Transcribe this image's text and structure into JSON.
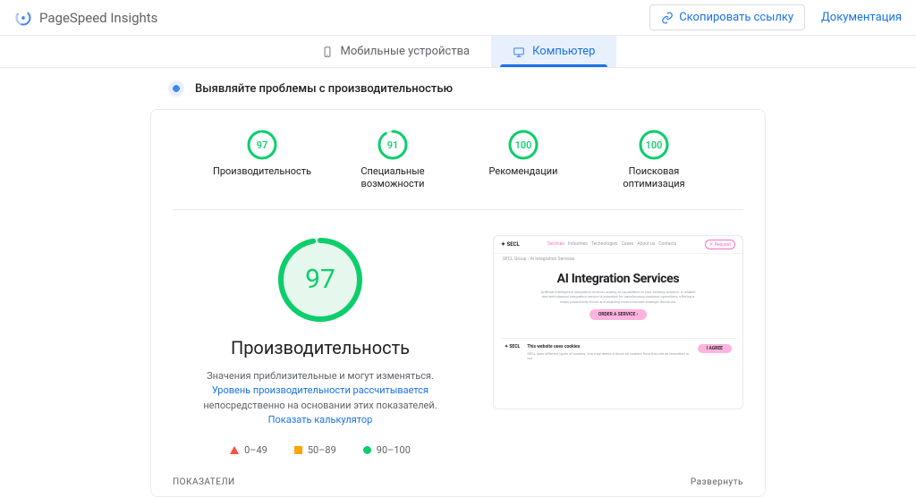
{
  "header": {
    "product": "PageSpeed Insights",
    "copy_link": "Скопировать ссылку",
    "docs": "Документация"
  },
  "tabs": {
    "mobile": "Мобильные устройства",
    "desktop": "Компьютер"
  },
  "sub": "Выявляйте проблемы с производительностью",
  "scores": [
    {
      "value": "97",
      "pct": 97,
      "label": "Производительность"
    },
    {
      "value": "91",
      "pct": 91,
      "label": "Специальные возможности"
    },
    {
      "value": "100",
      "pct": 100,
      "label": "Рекомендации"
    },
    {
      "value": "100",
      "pct": 100,
      "label": "Поисковая оптимизация"
    }
  ],
  "main": {
    "score": "97",
    "pct": 97,
    "title": "Производительность",
    "caption_pre": "Значения приблизительные и могут изменяться. ",
    "caption_link1": "Уровень производительности рассчитывается",
    "caption_mid": " непосредственно на основании этих показателей. ",
    "caption_link2": "Показать калькулятор"
  },
  "legend": {
    "low": "0–49",
    "mid": "50–89",
    "high": "90–100"
  },
  "preview": {
    "logo": "✦ SECL",
    "nav": [
      "Services",
      "Industries",
      "Technologies",
      "Cases",
      "About us",
      "Contacts"
    ],
    "request": "⦿ Request",
    "crumb": "SECL Group  ›  AI Integration Services",
    "hero_title": "AI Integration Services",
    "hero_text": "Artificial intelligence integration involves adding AI capabilities to your existing solution. A reliable and well-planned integration service is essential for transforming business operations, offering a major productivity boost and enabling more informed strategic decisions.",
    "cta": "ORDER A SERVICE ›",
    "cookie_title": "This website uses cookies",
    "cookie_text": "SECL uses different types of cookies. You may delete & block all cookies from this site as described in our",
    "cookie_btn": "I AGREE"
  },
  "footer": {
    "left": "ПОКАЗАТЕЛИ",
    "right": "Развернуть"
  }
}
